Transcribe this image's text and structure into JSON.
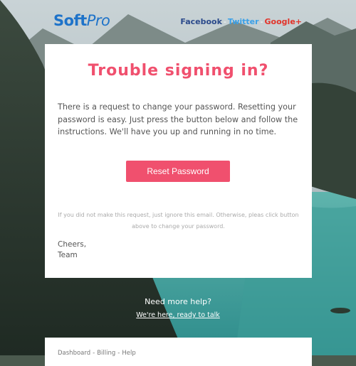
{
  "colors": {
    "brand": "#1e73c9",
    "accent": "#f0506e",
    "facebook": "#2b4a8b",
    "twitter": "#3aa0e8",
    "google": "#e2342a"
  },
  "header": {
    "logo_soft": "Soft",
    "logo_pro": "Pro",
    "social": [
      {
        "label": "Facebook"
      },
      {
        "label": "Twitter"
      },
      {
        "label": "Google+"
      }
    ],
    "separator": "-"
  },
  "card": {
    "title": "Trouble signing in?",
    "body": "There is a request to change your password. Resetting your password is easy. Just press the button below and follow the instructions. We'll have you up and running in no time.",
    "button_label": "Reset Password",
    "note": "If you did not make this request, just ignore this email. Otherwise, pleas click button above to change your password.",
    "signoff_1": "Cheers,",
    "signoff_2": "Team"
  },
  "help": {
    "title": "Need more help?",
    "link": "We're here, ready to talk"
  },
  "footer": {
    "links": [
      "Dashboard",
      "Billing",
      "Help"
    ],
    "separator": "-"
  },
  "background": {
    "description_icon": "mountain-lake-photo"
  }
}
